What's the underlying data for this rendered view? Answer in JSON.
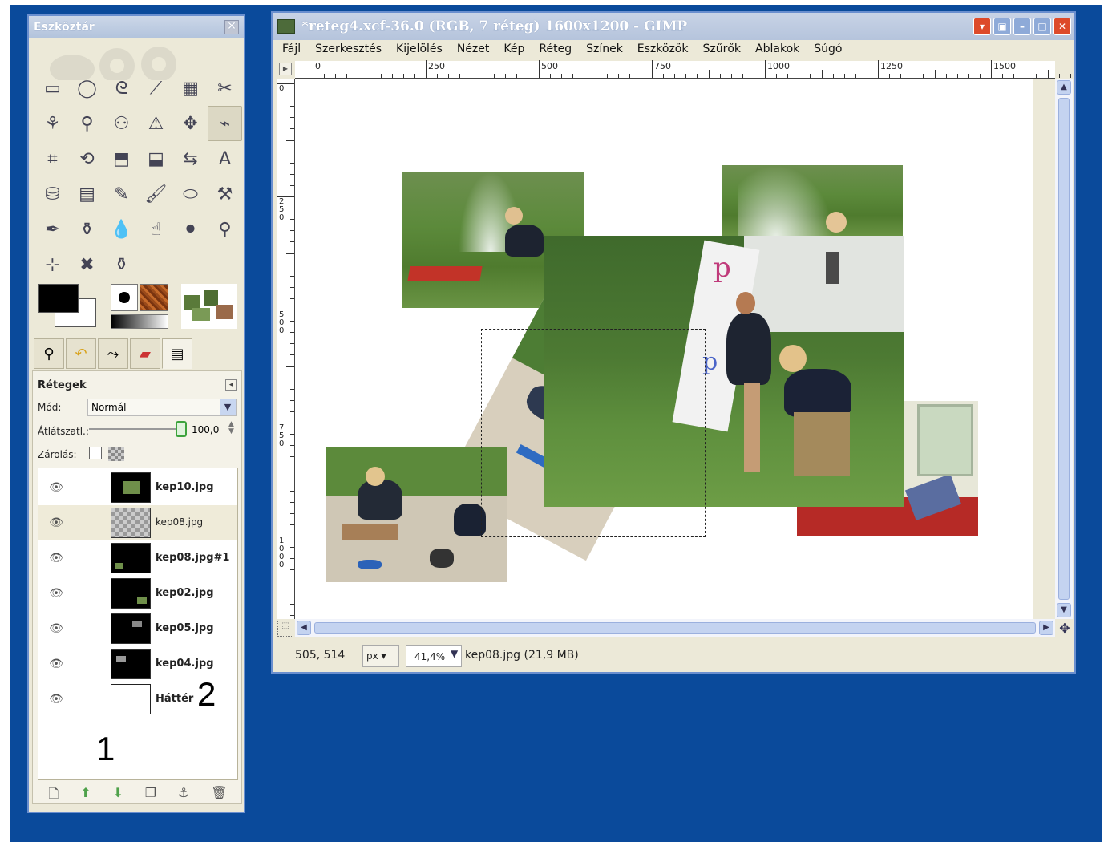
{
  "toolbox": {
    "title": "Eszköztár",
    "close_glyph": "✕",
    "tools": [
      {
        "name": "rect-select-icon",
        "glyph": "▭"
      },
      {
        "name": "ellipse-select-icon",
        "glyph": "◯"
      },
      {
        "name": "lasso-icon",
        "glyph": "ᘓ"
      },
      {
        "name": "magic-wand-icon",
        "glyph": "⟋"
      },
      {
        "name": "color-select-icon",
        "glyph": "▦"
      },
      {
        "name": "scissors-icon",
        "glyph": "✂"
      },
      {
        "name": "foreground-select-icon",
        "glyph": "⚘"
      },
      {
        "name": "color-picker-icon",
        "glyph": "⚲"
      },
      {
        "name": "zoom-person-icon",
        "glyph": "⚇"
      },
      {
        "name": "measure-icon",
        "glyph": "⚠"
      },
      {
        "name": "move-icon",
        "glyph": "✥"
      },
      {
        "name": "align-icon",
        "glyph": "⌁"
      },
      {
        "name": "crop-icon",
        "glyph": "⌗"
      },
      {
        "name": "rotate-icon",
        "glyph": "⟲"
      },
      {
        "name": "scale-icon",
        "glyph": "⬒"
      },
      {
        "name": "perspective-icon",
        "glyph": "⬓"
      },
      {
        "name": "flip-icon",
        "glyph": "⇆"
      },
      {
        "name": "text-icon",
        "glyph": "A"
      },
      {
        "name": "bucket-fill-icon",
        "glyph": "⛁"
      },
      {
        "name": "blend-icon",
        "glyph": "▤"
      },
      {
        "name": "pencil-icon",
        "glyph": "✎"
      },
      {
        "name": "paintbrush-icon",
        "glyph": "🖌"
      },
      {
        "name": "eraser-icon",
        "glyph": "⬭"
      },
      {
        "name": "airbrush-icon",
        "glyph": "⚒"
      },
      {
        "name": "ink-icon",
        "glyph": "✒"
      },
      {
        "name": "clone-icon",
        "glyph": "⚱"
      },
      {
        "name": "blur-icon",
        "glyph": "💧"
      },
      {
        "name": "smudge-icon",
        "glyph": "☝"
      },
      {
        "name": "dodge-burn-icon",
        "glyph": "⚫"
      },
      {
        "name": "magnify-icon",
        "glyph": "⚲"
      },
      {
        "name": "cage-transform-icon",
        "glyph": "⊹"
      },
      {
        "name": "heal-icon",
        "glyph": "✖"
      },
      {
        "name": "perspective-clone-icon",
        "glyph": "⚱"
      }
    ]
  },
  "layers_panel": {
    "title": "Rétegek",
    "mode_label": "Mód:",
    "mode_value": "Normál",
    "opacity_label": "Átlátszatl.:",
    "opacity_value": "100,0",
    "lock_label": "Zárolás:",
    "layers": [
      {
        "name": "kep10.jpg"
      },
      {
        "name": "kep08.jpg"
      },
      {
        "name": "kep08.jpg#1"
      },
      {
        "name": "kep02.jpg"
      },
      {
        "name": "kep05.jpg"
      },
      {
        "name": "kep04.jpg"
      },
      {
        "name": "Háttér"
      }
    ],
    "annotations": {
      "one": "1",
      "two": "2"
    }
  },
  "image_window": {
    "title": "*reteg4.xcf-36.0 (RGB, 7 réteg) 1600x1200 - GIMP",
    "menu": [
      "Fájl",
      "Szerkesztés",
      "Kijelölés",
      "Nézet",
      "Kép",
      "Réteg",
      "Színek",
      "Eszközök",
      "Szűrők",
      "Ablakok",
      "Súgó"
    ],
    "hruler_labels": [
      "0",
      "250",
      "500",
      "750",
      "1000",
      "1250",
      "1500"
    ],
    "vruler_labels": [
      "0",
      "250",
      "500",
      "750",
      "1000"
    ],
    "status": {
      "coords": "505, 514",
      "unit": "px",
      "zoom": "41,4%",
      "info": "kep08.jpg (21,9 MB)"
    }
  }
}
